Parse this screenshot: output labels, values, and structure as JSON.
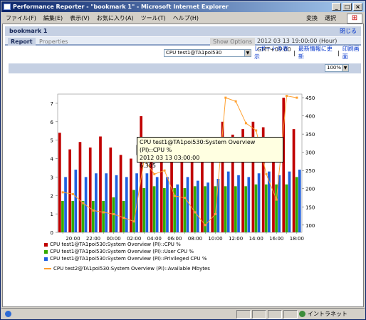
{
  "window": {
    "title": "Performance Reporter - \"bookmark 1\" - Microsoft Internet Explorer",
    "buttons": [
      "_",
      "□",
      "×"
    ]
  },
  "menu": {
    "items": [
      "ファイル(F)",
      "編集(E)",
      "表示(V)",
      "お気に入り(A)",
      "ツール(T)",
      "ヘルプ(H)"
    ],
    "tools": [
      "変換",
      "選択"
    ]
  },
  "page": {
    "bookmark_title": "bookmark 1",
    "close_label": "閉じる",
    "tab_report": "Report",
    "tab_properties": "Properties",
    "show_options": "Show Options",
    "datetime": "2012 03 13 19:00:00 (Hour) GMT+09:00",
    "report_select": "CPU test1@TA1poi530",
    "link_show": "レポートの表示",
    "link_refresh": "最新情報に更新",
    "link_print": "印刷画面",
    "zoom": "100%"
  },
  "tooltip": {
    "line1": "CPU test1@TA1poi530:System Overview (PI)::CPU %",
    "line2": "2012 03 13 03:00:00",
    "line3": "6.305"
  },
  "colors": {
    "cpu": "#c00000",
    "user": "#33aa00",
    "priv": "#2060e0",
    "mbytes": "#ffa030"
  },
  "chart_data": {
    "type": "bar",
    "categories": [
      "19:00",
      "20:00",
      "21:00",
      "22:00",
      "23:00",
      "00:00",
      "01:00",
      "02:00",
      "03:00",
      "04:00",
      "05:00",
      "06:00",
      "07:00",
      "08:00",
      "09:00",
      "10:00",
      "11:00",
      "12:00",
      "13:00",
      "14:00",
      "15:00",
      "16:00",
      "17:00",
      "18:00"
    ],
    "x_tick_labels": [
      "20:00",
      "22:00",
      "00:00",
      "02:00",
      "04:00",
      "06:00",
      "08:00",
      "10:00",
      "12:00",
      "14:00",
      "16:00",
      "18:00"
    ],
    "y_left": {
      "min": 0,
      "max": 7.5,
      "ticks": [
        "0",
        "1",
        "2",
        "3",
        "4",
        "5",
        "6",
        "7"
      ]
    },
    "y_right": {
      "min": 80,
      "max": 460,
      "ticks": [
        "100",
        "150",
        "200",
        "250",
        "300",
        "350",
        "400",
        "450"
      ]
    },
    "series": [
      {
        "name": "CPU test1@TA1poi530:System Overview (PI)::CPU %",
        "color": "#c00000",
        "axis": "left",
        "values": [
          5.4,
          4.5,
          4.9,
          4.6,
          5.2,
          4.6,
          4.2,
          4.0,
          6.3,
          4.4,
          4.0,
          4.2,
          4.3,
          4.3,
          4.2,
          4.2,
          6.0,
          5.3,
          5.6,
          6.0,
          5.7,
          4.4,
          7.3,
          5.6
        ]
      },
      {
        "name": "CPU test1@TA1poi530:System Overview (PI)::User CPU %",
        "color": "#33aa00",
        "axis": "left",
        "values": [
          1.7,
          1.7,
          1.7,
          1.7,
          1.7,
          1.9,
          1.7,
          2.3,
          2.4,
          2.5,
          2.4,
          2.4,
          2.4,
          2.5,
          2.5,
          2.5,
          2.5,
          2.5,
          2.5,
          2.6,
          2.6,
          2.6,
          2.6,
          3.0
        ]
      },
      {
        "name": "CPU test1@TA1poi530:System Overview (PI)::Privileged CPU %",
        "color": "#2060e0",
        "axis": "left",
        "values": [
          3.0,
          3.4,
          3.0,
          3.2,
          3.2,
          3.1,
          3.0,
          3.2,
          3.2,
          3.0,
          3.0,
          2.6,
          3.0,
          2.8,
          2.7,
          2.9,
          3.3,
          3.1,
          3.0,
          3.2,
          3.3,
          3.1,
          3.3,
          3.4
        ]
      },
      {
        "name": "CPU test2@TA1poi530:System Overview (PI)::Available Mbytes",
        "color": "#ffa030",
        "axis": "right",
        "type": "line",
        "values": [
          190,
          185,
          160,
          140,
          135,
          130,
          120,
          110,
          280,
          240,
          250,
          180,
          175,
          135,
          100,
          130,
          450,
          440,
          380,
          360,
          240,
          170,
          455,
          450
        ]
      }
    ]
  },
  "status": {
    "zone": "イントラネット"
  }
}
